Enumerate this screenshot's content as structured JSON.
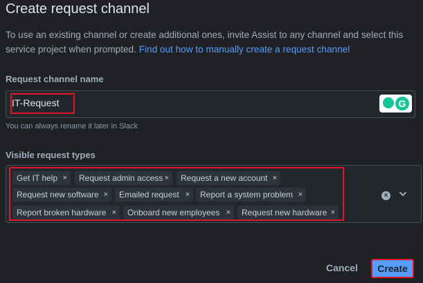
{
  "dialog": {
    "title": "Create request channel",
    "description": "To use an existing channel or create additional ones, invite Assist to any channel and select this service project when prompted.",
    "link_text": "Find out how to manually create a request channel"
  },
  "channel_name": {
    "label": "Request channel name",
    "value": "IT-Request",
    "hint": "You can always rename it later in Slack"
  },
  "request_types": {
    "label": "Visible request types",
    "chips": [
      {
        "label": "Get IT help"
      },
      {
        "label": "Request admin access"
      },
      {
        "label": "Request a new account"
      },
      {
        "label": "Request new software"
      },
      {
        "label": "Emailed request"
      },
      {
        "label": "Report a system problem"
      },
      {
        "label": "Report broken hardware"
      },
      {
        "label": "Onboard new employees"
      },
      {
        "label": "Request new hardware"
      }
    ],
    "remove_symbol": "×",
    "clear_symbol": "×"
  },
  "grammarly_letter": "G",
  "actions": {
    "cancel_label": "Cancel",
    "create_label": "Create"
  },
  "colors": {
    "background": "#1f2124",
    "accent": "#579dff",
    "highlight_border": "#e2142d",
    "chip_background": "#2c333a"
  },
  "icons": [
    "grammarly-icon",
    "clear-icon",
    "chevron-down-icon",
    "remove-chip-icon"
  ]
}
